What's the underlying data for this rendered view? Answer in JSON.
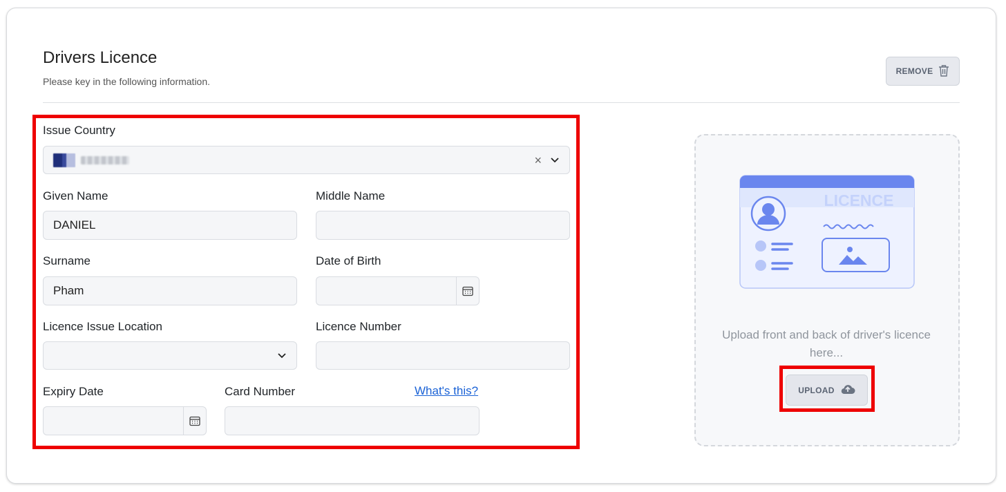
{
  "header": {
    "title": "Drivers Licence",
    "subtitle": "Please key in the following information.",
    "remove_label": "REMOVE"
  },
  "form": {
    "issue_country": {
      "label": "Issue Country",
      "clear_glyph": "×"
    },
    "given_name": {
      "label": "Given Name",
      "value": "DANIEL"
    },
    "middle_name": {
      "label": "Middle Name",
      "value": ""
    },
    "surname": {
      "label": "Surname",
      "value": "Pham"
    },
    "date_of_birth": {
      "label": "Date of Birth",
      "value": ""
    },
    "licence_issue_location": {
      "label": "Licence Issue Location",
      "value": ""
    },
    "licence_number": {
      "label": "Licence Number",
      "value": ""
    },
    "expiry_date": {
      "label": "Expiry Date",
      "value": ""
    },
    "card_number": {
      "label": "Card Number",
      "value": "",
      "help_link": "What's this?"
    }
  },
  "upload": {
    "illustration_text": "LICENCE",
    "instruction": "Upload front and back of driver's licence here...",
    "button_label": "UPLOAD"
  },
  "colors": {
    "highlight": "#ee0000",
    "link": "#1a62d6",
    "illustration_accent": "#6a86ee"
  },
  "icons": [
    "trash-icon",
    "chevron-down-icon",
    "calendar-icon",
    "cloud-upload-icon",
    "clear-icon"
  ]
}
